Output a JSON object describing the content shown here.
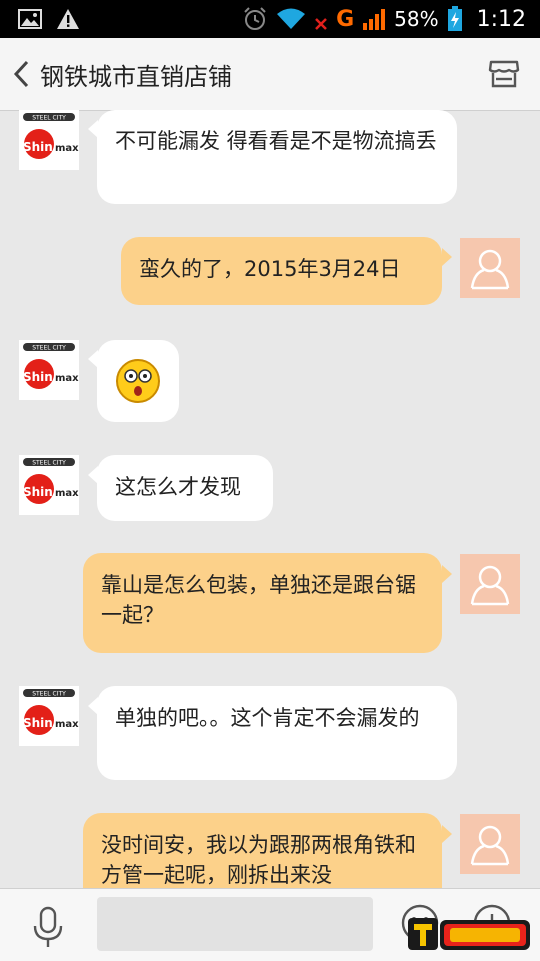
{
  "status_bar": {
    "carrier": "G",
    "battery_percent": "58%",
    "time": "1:12"
  },
  "header": {
    "title": "钢铁城市直销店铺",
    "back_icon": "chevron-left-icon",
    "store_icon": "store-icon"
  },
  "messages": [
    {
      "sender": "shop",
      "text": "不可能漏发 得看看是不是物流搞丢"
    },
    {
      "sender": "me",
      "text": "蛮久的了，2015年3月24日"
    },
    {
      "sender": "shop",
      "text": "",
      "emoji": "surprised-emoji"
    },
    {
      "sender": "shop",
      "text": "这怎么才发现"
    },
    {
      "sender": "me",
      "text": "靠山是怎么包装，单独还是跟台锯一起？"
    },
    {
      "sender": "shop",
      "text": "单独的吧。。这个肯定不会漏发的"
    },
    {
      "sender": "me",
      "text": "没时间安，我以为跟那两根角铁和方管一起呢，刚拆出来没"
    }
  ],
  "shop_avatar": {
    "top_text": "STEEL CITY",
    "brand_red": "Shin",
    "brand_black": "max"
  },
  "input": {
    "value": "",
    "placeholder": ""
  },
  "colors": {
    "incoming_bubble": "#ffffff",
    "outgoing_bubble": "#fcd18a",
    "user_avatar": "#f6c7ae",
    "background": "#e8e8e8"
  }
}
